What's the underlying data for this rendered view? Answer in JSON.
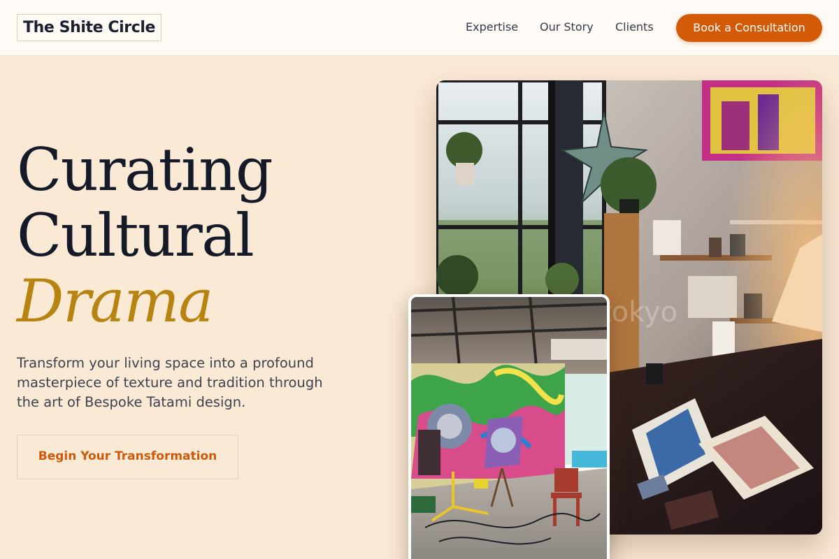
{
  "brand": {
    "name": "The Shite Circle"
  },
  "nav": {
    "links": [
      "Expertise",
      "Our Story",
      "Clients"
    ],
    "cta_label": "Book a Consultation"
  },
  "hero": {
    "title_line1": "Curating",
    "title_line2": "Cultural",
    "title_accent": "Drama",
    "subtitle": "Transform your living space into a profound masterpiece of texture and tradition through the art of Bespoke Tatami design.",
    "button_label": "Begin Your Transformation"
  },
  "images": {
    "main_watermark": "tokyo"
  },
  "colors": {
    "background": "#fae9d5",
    "header_background": "#fffaf5",
    "accent_orange": "#d35a07",
    "accent_gold": "#b78412",
    "heading": "#151a28"
  }
}
